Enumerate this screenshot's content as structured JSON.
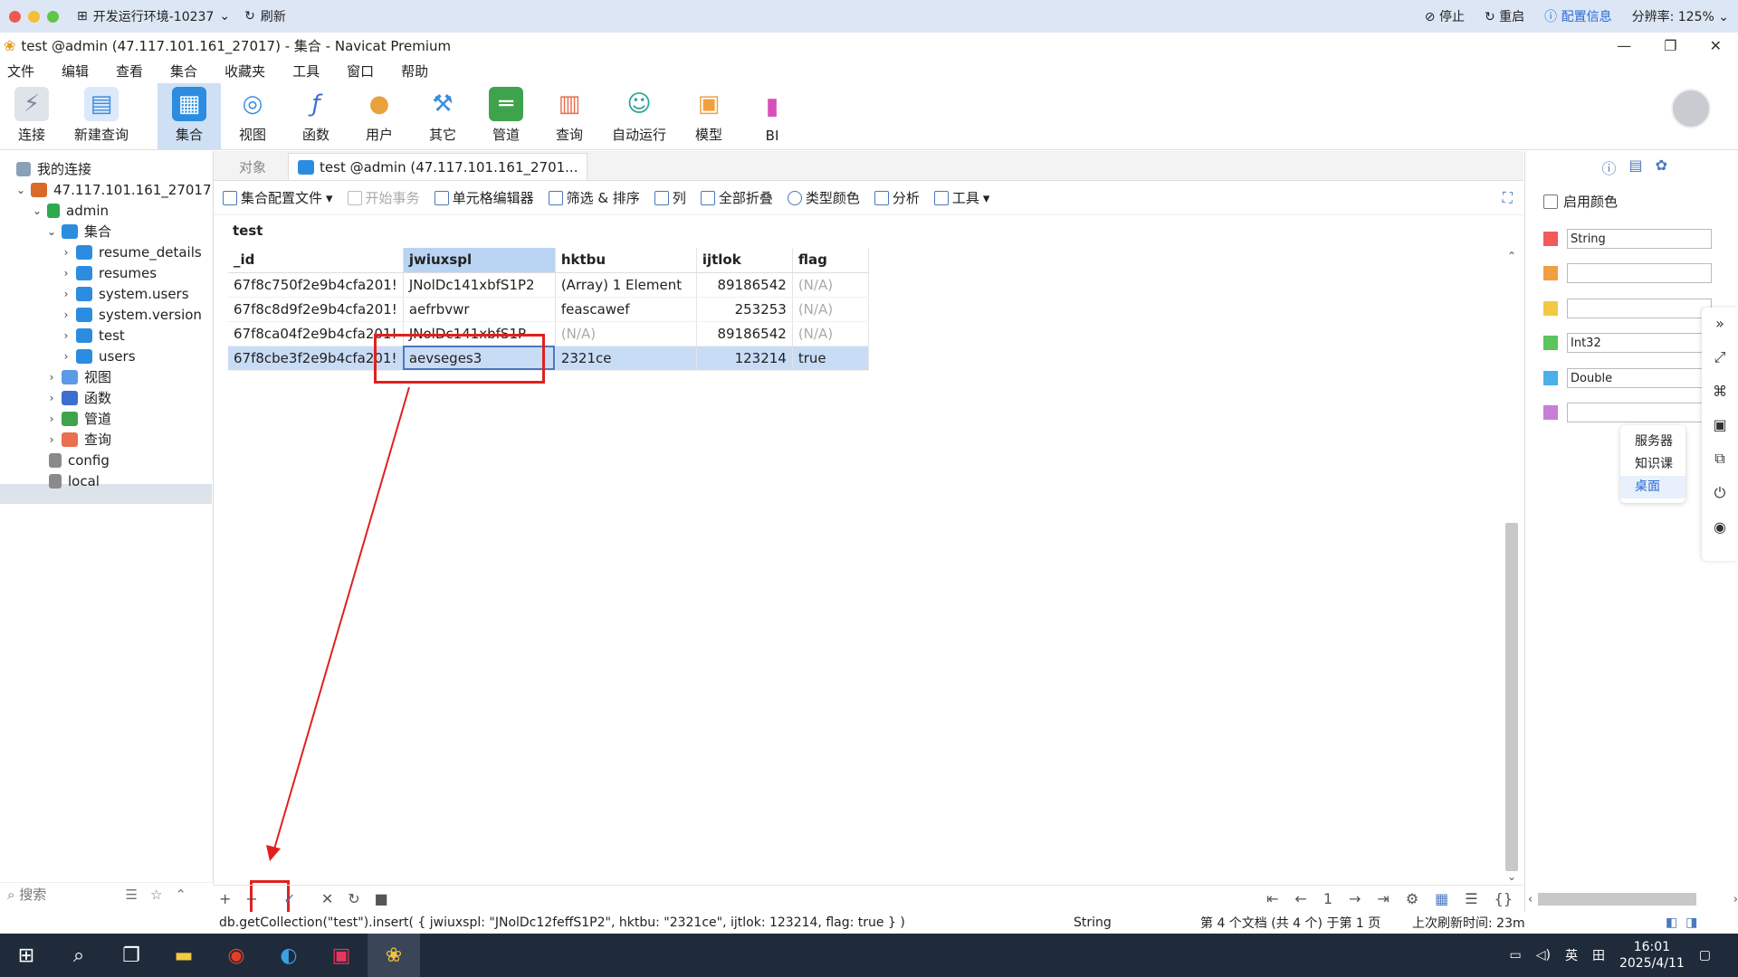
{
  "remote": {
    "env_label": "开发运行环境-10237",
    "refresh": "刷新",
    "stop": "停止",
    "restart": "重启",
    "config": "配置信息",
    "resolution": "分辨率: 125%"
  },
  "window": {
    "title": "test @admin (47.117.101.161_27017) - 集合 - Navicat Premium"
  },
  "menu": [
    "文件",
    "编辑",
    "查看",
    "集合",
    "收藏夹",
    "工具",
    "窗口",
    "帮助"
  ],
  "toolbar": [
    {
      "label": "连接",
      "icon": "plug-icon",
      "color": "#7a8aa0"
    },
    {
      "label": "新建查询",
      "icon": "new-query-icon",
      "color": "#3b8de0"
    },
    {
      "label": "集合",
      "icon": "collection-icon",
      "color": "#2c8ce0"
    },
    {
      "label": "视图",
      "icon": "view-icon",
      "color": "#3b8de0"
    },
    {
      "label": "函数",
      "icon": "function-icon",
      "color": "#3b6fd0"
    },
    {
      "label": "用户",
      "icon": "user-icon",
      "color": "#e9a23b"
    },
    {
      "label": "其它",
      "icon": "tools-icon",
      "color": "#3b8de0"
    },
    {
      "label": "管道",
      "icon": "pipeline-icon",
      "color": "#3fa34d"
    },
    {
      "label": "查询",
      "icon": "query-icon",
      "color": "#e86f4f"
    },
    {
      "label": "自动运行",
      "icon": "robot-icon",
      "color": "#2aa39a"
    },
    {
      "label": "模型",
      "icon": "model-icon",
      "color": "#f0a040"
    },
    {
      "label": "BI",
      "icon": "bi-icon",
      "color": "#d94fb8"
    }
  ],
  "nav": {
    "root": "我的连接",
    "connection": "47.117.101.161_27017",
    "db": "admin",
    "collections_group": "集合",
    "collections": [
      "resume_details",
      "resumes",
      "system.users",
      "system.version",
      "test",
      "users"
    ],
    "groups": [
      "视图",
      "函数",
      "管道",
      "查询"
    ],
    "other_dbs": [
      "config",
      "local"
    ],
    "search_placeholder": "搜索"
  },
  "tabs": {
    "objects": "对象",
    "active": "test @admin (47.117.101.161_2701..."
  },
  "subbar": {
    "profile": "集合配置文件",
    "begin_tx": "开始事务",
    "cell_editor": "单元格编辑器",
    "filter_sort": "筛选 & 排序",
    "columns": "列",
    "collapse_all": "全部折叠",
    "type_color": "类型颜色",
    "analyze": "分析",
    "tools": "工具"
  },
  "grid": {
    "collection": "test",
    "columns": [
      "_id",
      "jwiuxspl",
      "hktbu",
      "ijtlok",
      "flag"
    ],
    "rows": [
      {
        "id": "67f8c750f2e9b4cfa201!",
        "jwiuxspl": "JNolDc141xbfS1P2",
        "hktbu": "(Array) 1 Element",
        "ijtlok": "89186542",
        "flag": "(N/A)"
      },
      {
        "id": "67f8c8d9f2e9b4cfa201!",
        "jwiuxspl": "aefrbvwr",
        "hktbu": "feascawef",
        "ijtlok": "253253",
        "flag": "(N/A)"
      },
      {
        "id": "67f8ca04f2e9b4cfa201!",
        "jwiuxspl": "JNolDc141xbfS1P",
        "hktbu": "(N/A)",
        "ijtlok": "89186542",
        "flag": "(N/A)"
      },
      {
        "id": "67f8cbe3f2e9b4cfa201!",
        "jwiuxspl": "aevseges3",
        "hktbu": "2321ce",
        "ijtlok": "123214",
        "flag": "true"
      }
    ]
  },
  "bottom": {
    "page": "1"
  },
  "status": {
    "query": "db.getCollection(\"test\").insert( { jwiuxspl: \"JNolDc12feffS1P2\", hktbu: \"2321ce\", ijtlok: 123214, flag: true } )",
    "type": "String",
    "info": "第 4 个文档 (共 4 个) 于第 1 页",
    "refresh": "上次刷新时间: 23m"
  },
  "right": {
    "enable_color": "启用颜色",
    "colors": [
      {
        "color": "#f05a5a",
        "value": "String"
      },
      {
        "color": "#f0a040",
        "value": ""
      },
      {
        "color": "#f5c842",
        "value": ""
      },
      {
        "color": "#5cc45c",
        "value": "Int32"
      },
      {
        "color": "#4ab0e8",
        "value": "Double"
      },
      {
        "color": "#c77ed8",
        "value": ""
      }
    ],
    "menu": [
      "服务器",
      "知识课",
      "桌面"
    ]
  },
  "taskbar": {
    "ime": "英",
    "time": "16:01",
    "date": "2025/4/11"
  }
}
